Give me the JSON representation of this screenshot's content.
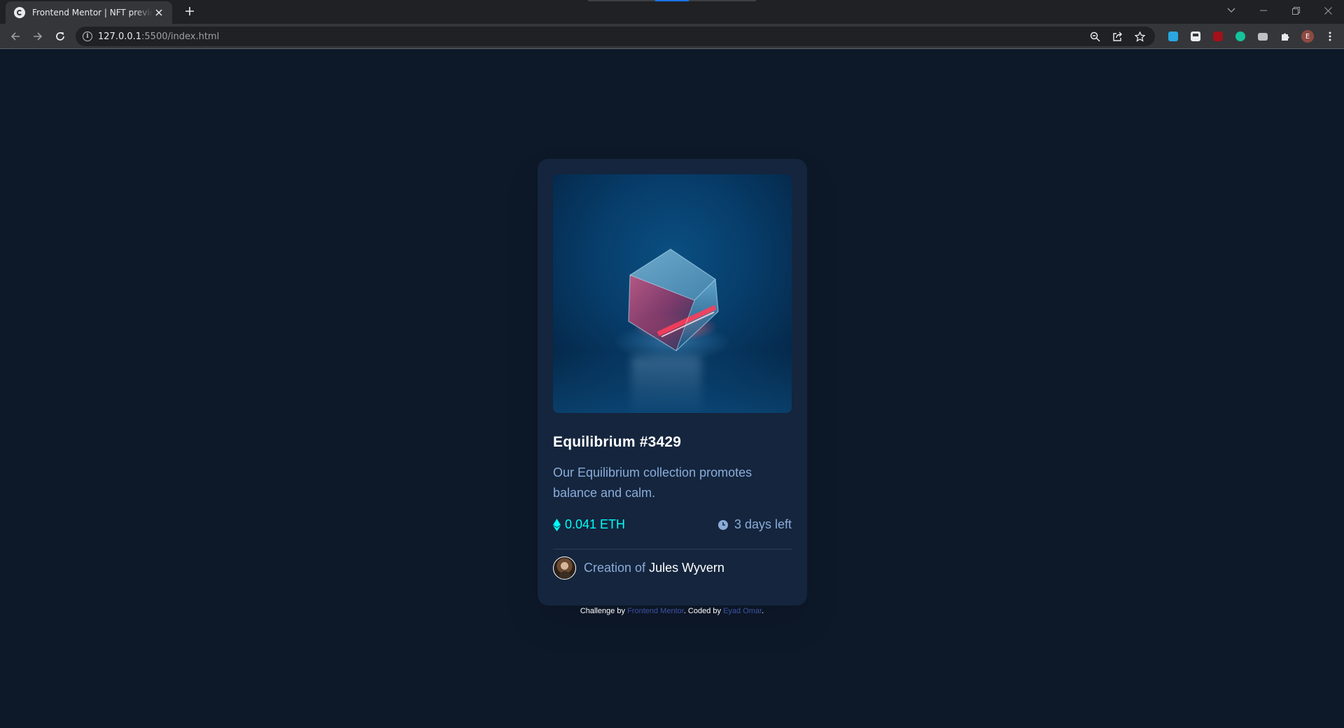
{
  "browser": {
    "tab_title": "Frontend Mentor | NFT preview card component",
    "url_host": "127.0.0.1",
    "url_rest": ":5500/index.html",
    "profile_initial": "E"
  },
  "card": {
    "title": "Equilibrium #3429",
    "description": "Our Equilibrium collection promotes balance and calm.",
    "price": "0.041 ETH",
    "time_left": "3 days left",
    "creator_prefix": "Creation of",
    "creator_name": "Jules Wyvern"
  },
  "attribution": {
    "prefix": "Challenge by ",
    "link1": "Frontend Mentor",
    "middle": ". Coded by ",
    "link2": "Eyad Omar",
    "suffix": "."
  },
  "colors": {
    "page_bg": "#0d1829",
    "card_bg": "#14253d",
    "cyan": "#00fff8",
    "soft_blue": "#8bacd9",
    "white": "#ffffff"
  },
  "icons": {
    "eth": "ethereum-icon",
    "clock": "clock-icon"
  }
}
